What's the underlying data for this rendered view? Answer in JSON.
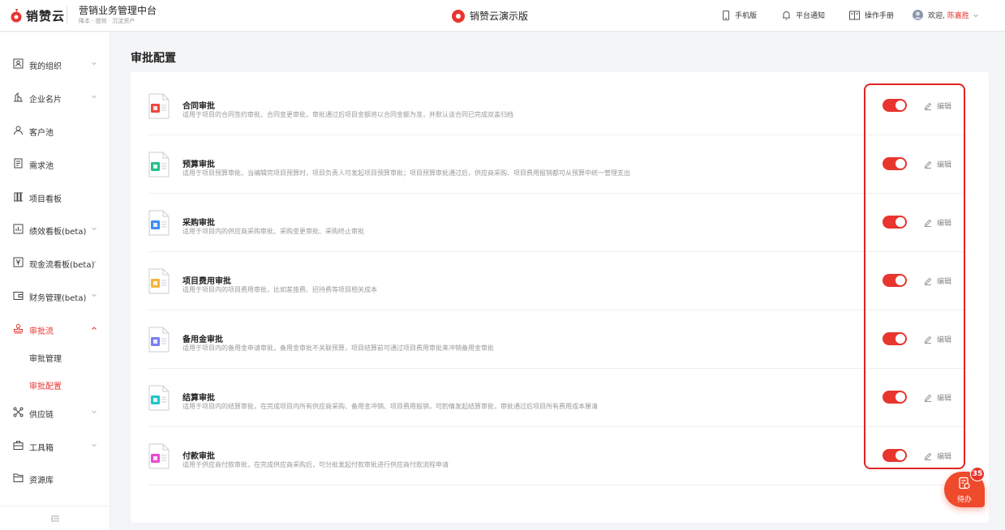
{
  "header": {
    "logo_text": "销赞云",
    "product_title": "营销业务管理中台",
    "product_subtitle": "降本 · 提效 · 沉淀资产",
    "center_title": "销赞云演示版",
    "mobile_label": "手机版",
    "notify_label": "平台通知",
    "manual_label": "操作手册",
    "welcome_label": "欢迎,",
    "user_name": "陈嘉胜"
  },
  "sidebar": {
    "items": [
      {
        "label": "我的组织"
      },
      {
        "label": "企业名片"
      },
      {
        "label": "客户池"
      },
      {
        "label": "需求池"
      },
      {
        "label": "项目看板"
      },
      {
        "label": "绩效看板(beta)"
      },
      {
        "label": "现金流看板(beta)"
      },
      {
        "label": "财务管理(beta)"
      },
      {
        "label": "审批流"
      },
      {
        "label": "供应链"
      },
      {
        "label": "工具箱"
      },
      {
        "label": "资源库"
      }
    ],
    "sub_items": [
      {
        "label": "审批管理"
      },
      {
        "label": "审批配置"
      }
    ]
  },
  "main": {
    "title": "审批配置",
    "edit_label": "编辑",
    "rows": [
      {
        "title": "合同审批",
        "desc": "适用于项目的合同签约审批、合同变更审批，审批通过后项目金额将以合同金额为准，并默认该合同已完成双盖归档",
        "color": "#f0483e",
        "enabled": true
      },
      {
        "title": "预算审批",
        "desc": "适用于项目预算审批，当编辑完项目预算时，项目负责人可发起项目预算审批；项目预算审批通过后，供应商采购、项目费用报销都可从预算中统一管理支出",
        "color": "#26c08a",
        "enabled": true
      },
      {
        "title": "采购审批",
        "desc": "适用于项目内的供应商采购审批、采购变更审批、采购终止审批",
        "color": "#3d8ef8",
        "enabled": true
      },
      {
        "title": "项目费用审批",
        "desc": "适用于项目内的项目费用审批，比如差旅费、招待费等项目相关成本",
        "color": "#f8b43a",
        "enabled": true
      },
      {
        "title": "备用金审批",
        "desc": "适用于项目内的备用金申请审批，备用金审批不关联预算，项目结算前可通过项目费用审批来冲销备用金审批",
        "color": "#7b7ff0",
        "enabled": true
      },
      {
        "title": "结算审批",
        "desc": "适用于项目内的结算审批，在完成项目内所有供应商采购、备用金冲销、项目费用报销，可酌情发起结算审批，审批通过后项目所有费用成本厘清",
        "color": "#23c3c9",
        "enabled": true
      },
      {
        "title": "付款审批",
        "desc": "适用于供应商付款审批，在完成供应商采购后，可分批发起付款审批进行供应商付款流程申请",
        "color": "#e84bd0",
        "enabled": true
      }
    ]
  },
  "todo": {
    "label": "待办",
    "count": "35"
  },
  "colors": {
    "accent": "#e8352e",
    "highlight_border": "#e02424"
  }
}
